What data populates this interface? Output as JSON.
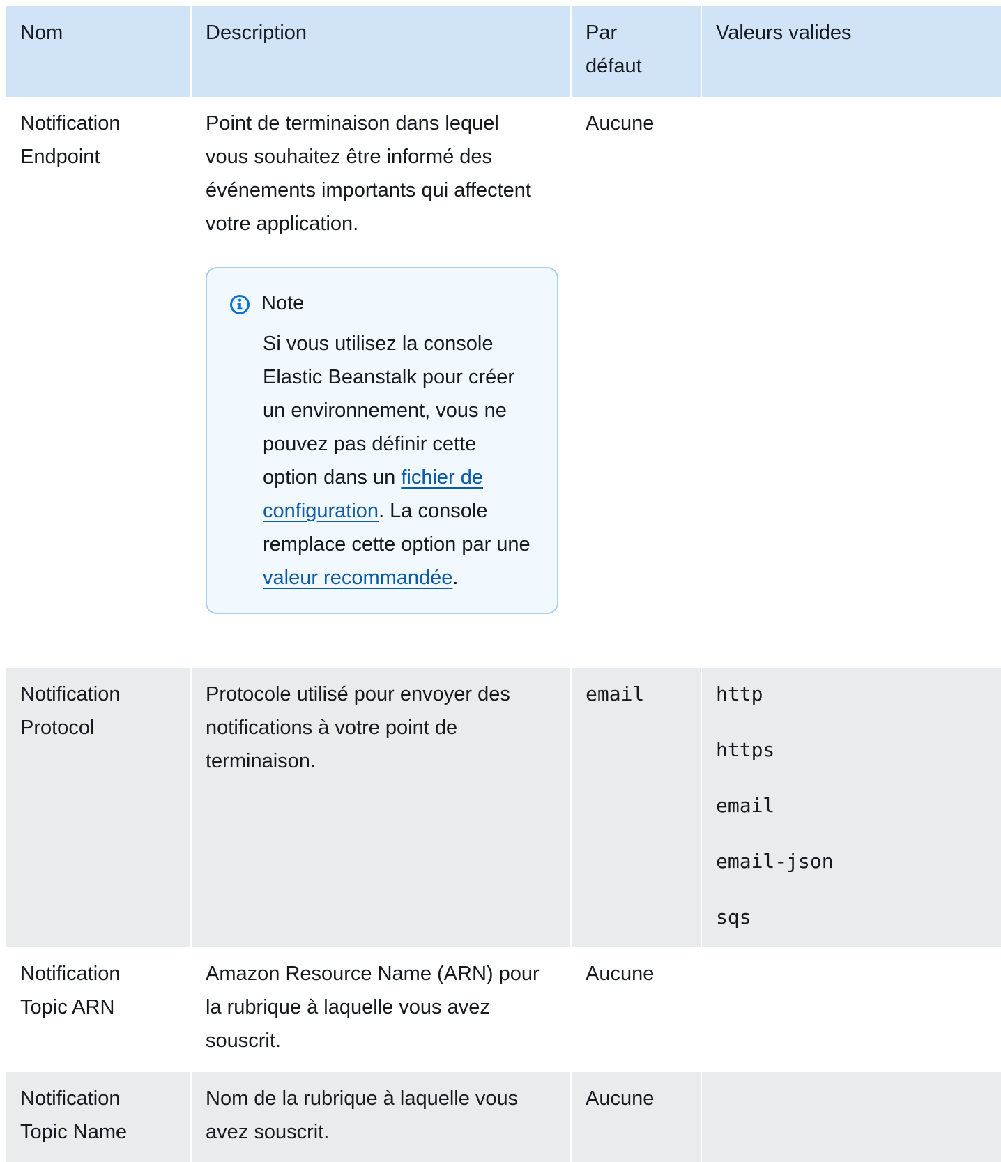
{
  "header": {
    "col_name": "Nom",
    "col_description": "Description",
    "col_default": "Par défaut",
    "col_valid": "Valeurs valides"
  },
  "rows": [
    {
      "name": "Notification Endpoint",
      "description": "Point de terminaison dans lequel vous souhaitez être informé des événements importants qui affectent votre application.",
      "default": "Aucune",
      "note": {
        "title": "Note",
        "text_1": "Si vous utilisez la console Elastic Beanstalk pour créer un environnement, vous ne pouvez pas définir cette option dans un ",
        "link_1": "fichier de configuration",
        "text_2": ". La console remplace cette option par une ",
        "link_2": "valeur recommandée",
        "text_3": "."
      }
    },
    {
      "name": "Notification Protocol",
      "description": "Protocole utilisé pour envoyer des notifications à votre point de terminaison.",
      "default": "email",
      "valid_values": [
        "http",
        "https",
        "email",
        "email-json",
        "sqs"
      ]
    },
    {
      "name": "Notification Topic ARN",
      "description": "Amazon Resource Name (ARN) pour la rubrique à laquelle vous avez souscrit.",
      "default": "Aucune"
    },
    {
      "name": "Notification Topic Name",
      "description": "Nom de la rubrique à laquelle vous avez souscrit.",
      "default": "Aucune"
    }
  ],
  "colors": {
    "header_bg": "#d1e4f7",
    "row_alt_bg": "#eaebed",
    "note_bg": "#f1f8fe",
    "note_border": "#a8d0ee",
    "link": "#0b5ba8",
    "info_icon": "#0972d3"
  }
}
